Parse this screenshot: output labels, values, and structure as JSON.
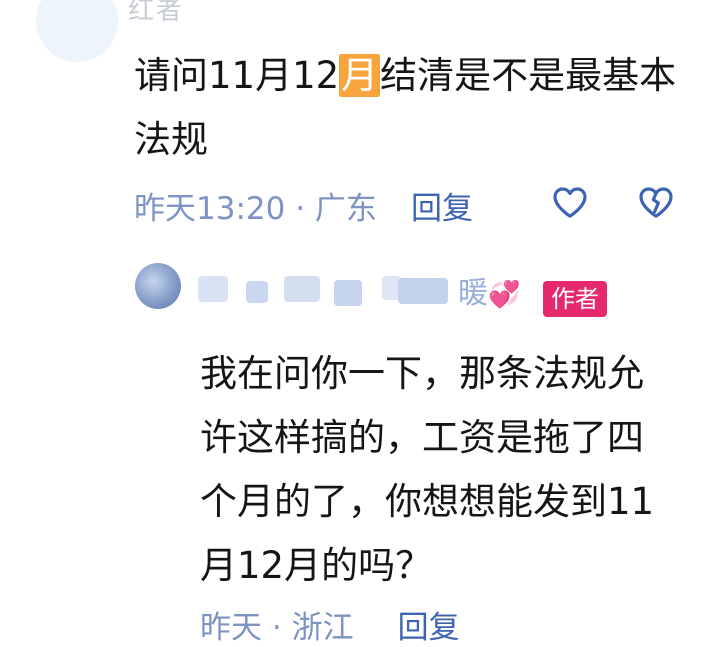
{
  "comment1": {
    "username_partial": "红者",
    "text_before": "请问11月12",
    "text_highlight": "月",
    "text_after": "结清是不是最基本法规",
    "timestamp": "昨天13:20",
    "location": "广东",
    "separator": "·",
    "reply_label": "回复"
  },
  "comment2": {
    "username_partial": "暖",
    "emoji": "💞",
    "author_badge": "作者",
    "text": "我在问你一下，那条法规允许这样搞的，工资是拖了四个月的了，你想想能发到11月12月的吗？",
    "timestamp": "昨天",
    "location": "浙江",
    "separator": "·",
    "reply_label": "回复"
  },
  "colors": {
    "meta": "#7d93c4",
    "reply": "#3d64b3",
    "badge": "#e6286c",
    "highlight": "#f6a43b",
    "icon": "#3d64b3"
  },
  "icons": [
    "heart-outline-icon",
    "broken-heart-icon"
  ]
}
